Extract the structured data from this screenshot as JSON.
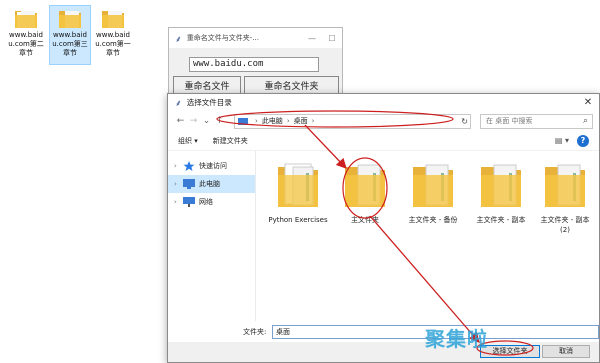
{
  "desktop": {
    "icons": [
      {
        "label": "www.baidu.com第二章节",
        "selected": false
      },
      {
        "label": "www.baidu.com第三章节",
        "selected": true
      },
      {
        "label": "www.baidu.com第一章节",
        "selected": false
      }
    ]
  },
  "bg_window": {
    "title": "重命名文件与文件夹-...",
    "url_value": "www.baidu.com",
    "rename_file_button": "重命名文件",
    "rename_folder_button": "重命名文件夹"
  },
  "dialog": {
    "title": "选择文件目录",
    "close_icon": "close-icon",
    "address": {
      "segments": [
        "此电脑",
        "桌面"
      ]
    },
    "search_placeholder": "在 桌面 中搜索",
    "toolbar": {
      "organize": "组织 ▾",
      "new_folder": "新建文件夹"
    },
    "nav_items": [
      {
        "label": "快速访问",
        "icon": "star-icon",
        "selected": false
      },
      {
        "label": "此电脑",
        "icon": "pc-icon",
        "selected": true
      },
      {
        "label": "网络",
        "icon": "network-icon",
        "selected": false
      }
    ],
    "files": [
      {
        "name": "Python Exercises"
      },
      {
        "name": "主文件夹"
      },
      {
        "name": "主文件夹 - 备份"
      },
      {
        "name": "主文件夹 - 副本"
      },
      {
        "name": "主文件夹 - 副本 (2)"
      }
    ],
    "folder_label": "文件夹:",
    "folder_value": "桌面",
    "select_button": "选择文件夹",
    "cancel_button": "取消"
  },
  "watermark": "聚集啦",
  "colors": {
    "annotation": "#cc1f1f",
    "selection": "#cce8ff",
    "folder": "#f5c542",
    "accent": "#0078d7"
  }
}
